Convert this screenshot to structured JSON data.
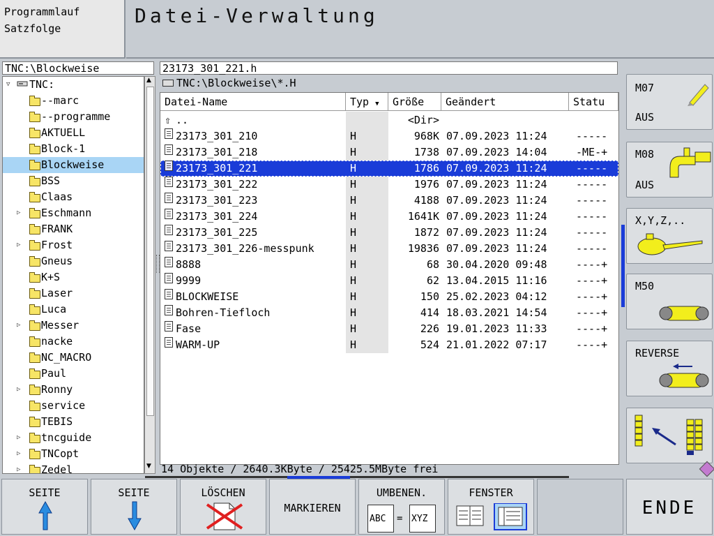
{
  "header": {
    "mode_line1": "Programmlauf",
    "mode_line2": "Satzfolge",
    "title": "Datei-Verwaltung"
  },
  "tree": {
    "path": "TNC:\\Blockweise",
    "root": "TNC:",
    "items": [
      {
        "label": "--marc",
        "expandable": false
      },
      {
        "label": "--programme",
        "expandable": false
      },
      {
        "label": "AKTUELL",
        "expandable": false
      },
      {
        "label": "Block-1",
        "expandable": false
      },
      {
        "label": "Blockweise",
        "expandable": false,
        "selected": true
      },
      {
        "label": "BSS",
        "expandable": false
      },
      {
        "label": "Claas",
        "expandable": false
      },
      {
        "label": "Eschmann",
        "expandable": true
      },
      {
        "label": "FRANK",
        "expandable": false
      },
      {
        "label": "Frost",
        "expandable": true
      },
      {
        "label": "Gneus",
        "expandable": false
      },
      {
        "label": "K+S",
        "expandable": false
      },
      {
        "label": "Laser",
        "expandable": false
      },
      {
        "label": "Luca",
        "expandable": false
      },
      {
        "label": "Messer",
        "expandable": true
      },
      {
        "label": "nacke",
        "expandable": false
      },
      {
        "label": "NC_MACRO",
        "expandable": false
      },
      {
        "label": "Paul",
        "expandable": false
      },
      {
        "label": "Ronny",
        "expandable": true
      },
      {
        "label": "service",
        "expandable": false
      },
      {
        "label": "TEBIS",
        "expandable": false
      },
      {
        "label": "tncguide",
        "expandable": true
      },
      {
        "label": "TNCopt",
        "expandable": true
      },
      {
        "label": "Zedel",
        "expandable": true
      }
    ]
  },
  "files": {
    "current_file": "23173_301_221.h",
    "filter": "TNC:\\Blockweise\\*.H",
    "columns": {
      "name": "Datei-Name",
      "type": "Typ",
      "size": "Größe",
      "changed": "Geändert",
      "status": "Statu"
    },
    "up_dir": {
      "name": "..",
      "size": "<Dir>"
    },
    "rows": [
      {
        "name": "23173_301_210",
        "type": "H",
        "size": "968K",
        "date": "07.09.2023",
        "time": "11:24",
        "status": "-----"
      },
      {
        "name": "23173_301_218",
        "type": "H",
        "size": "1738",
        "date": "07.09.2023",
        "time": "14:04",
        "status": "-ME-+"
      },
      {
        "name": "23173_301_221",
        "type": "H",
        "size": "1786",
        "date": "07.09.2023",
        "time": "11:24",
        "status": "-----",
        "selected": true
      },
      {
        "name": "23173_301_222",
        "type": "H",
        "size": "1976",
        "date": "07.09.2023",
        "time": "11:24",
        "status": "-----"
      },
      {
        "name": "23173_301_223",
        "type": "H",
        "size": "4188",
        "date": "07.09.2023",
        "time": "11:24",
        "status": "-----"
      },
      {
        "name": "23173_301_224",
        "type": "H",
        "size": "1641K",
        "date": "07.09.2023",
        "time": "11:24",
        "status": "-----"
      },
      {
        "name": "23173_301_225",
        "type": "H",
        "size": "1872",
        "date": "07.09.2023",
        "time": "11:24",
        "status": "-----"
      },
      {
        "name": "23173_301_226-messpunk",
        "type": "H",
        "size": "19836",
        "date": "07.09.2023",
        "time": "11:24",
        "status": "-----"
      },
      {
        "name": "8888",
        "type": "H",
        "size": "68",
        "date": "30.04.2020",
        "time": "09:48",
        "status": "----+"
      },
      {
        "name": "9999",
        "type": "H",
        "size": "62",
        "date": "13.04.2015",
        "time": "11:16",
        "status": "----+"
      },
      {
        "name": "BLOCKWEISE",
        "type": "H",
        "size": "150",
        "date": "25.02.2023",
        "time": "04:12",
        "status": "----+"
      },
      {
        "name": "Bohren-Tiefloch",
        "type": "H",
        "size": "414",
        "date": "18.03.2021",
        "time": "14:54",
        "status": "----+"
      },
      {
        "name": "Fase",
        "type": "H",
        "size": "226",
        "date": "19.01.2023",
        "time": "11:33",
        "status": "----+"
      },
      {
        "name": "WARM-UP",
        "type": "H",
        "size": "524",
        "date": "21.01.2022",
        "time": "07:17",
        "status": "----+"
      }
    ],
    "status_line": "14 Objekte / 2640.3KByte / 25425.5MByte frei"
  },
  "side_keys": {
    "m07": {
      "label": "M07",
      "state": "AUS"
    },
    "m08": {
      "label": "M08",
      "state": "AUS"
    },
    "xyz": {
      "label": "X,Y,Z,.."
    },
    "m50": {
      "label": "M50"
    },
    "reverse": {
      "label": "REVERSE"
    }
  },
  "bottom_keys": {
    "page_up": "SEITE",
    "page_down": "SEITE",
    "delete": "LÖSCHEN",
    "mark": "MARKIEREN",
    "rename": "UMBENEN.",
    "rename_from": "ABC",
    "rename_eq": "=",
    "rename_to": "XYZ",
    "window": "FENSTER",
    "end": "ENDE"
  },
  "colors": {
    "selection": "#1a3cd8",
    "tree_selection": "#a9d5f5",
    "folder": "#f7e566",
    "accent_yellow": "#f2ee1c"
  }
}
